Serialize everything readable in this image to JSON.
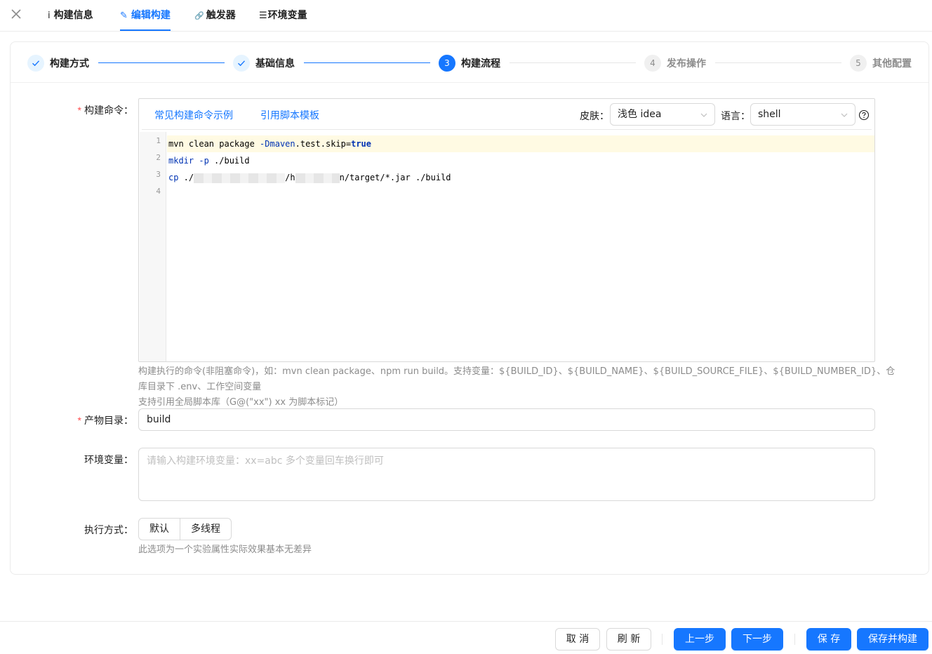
{
  "tabs": [
    {
      "icon": "i",
      "label": "构建信息"
    },
    {
      "icon": "✎",
      "label": "编辑构建"
    },
    {
      "icon": "🔗",
      "label": "触发器"
    },
    {
      "icon": "☰",
      "label": "环境变量"
    }
  ],
  "active_tab": "编辑构建",
  "steps": [
    {
      "index": "1",
      "title": "构建方式",
      "status": "done"
    },
    {
      "index": "2",
      "title": "基础信息",
      "status": "done"
    },
    {
      "index": "3",
      "title": "构建流程",
      "status": "current"
    },
    {
      "index": "4",
      "title": "发布操作",
      "status": "todo"
    },
    {
      "index": "5",
      "title": "其他配置",
      "status": "todo"
    }
  ],
  "command": {
    "label": "构建命令：",
    "toolbar": {
      "example_link": "常见构建命令示例",
      "template_link": "引用脚本模板",
      "skin_label": "皮肤：",
      "skin_value": "浅色 idea",
      "lang_label": "语言：",
      "lang_value": "shell"
    },
    "line_numbers": [
      "1",
      "2",
      "3",
      "4"
    ],
    "lines": {
      "l1": {
        "a": "mvn clean package ",
        "b": "-Dmaven",
        "c": ".test.skip=",
        "d": "true"
      },
      "l2": {
        "a": "mkdir",
        "b": " -p",
        "c": " ./build"
      },
      "l3": {
        "a": "cp",
        "b": " ./",
        "c": "/h",
        "d": "n/target/*.jar ./build"
      }
    },
    "hint1": "构建执行的命令(非阻塞命令)，如：mvn clean package、npm run build。支持变量：${BUILD_ID}、${BUILD_NAME}、${BUILD_SOURCE_FILE}、${BUILD_NUMBER_ID}、仓",
    "hint2": "库目录下 .env、工作空间变量",
    "hint3": "支持引用全局脚本库（G@(\"xx\") xx 为脚本标记）"
  },
  "artifact": {
    "label": "产物目录：",
    "value": "build"
  },
  "env": {
    "label": "环境变量：",
    "placeholder": "请输入构建环境变量：xx=abc 多个变量回车换行即可"
  },
  "exec": {
    "label": "执行方式：",
    "options": [
      "默认",
      "多线程"
    ],
    "hint": "此选项为一个实验属性实际效果基本无差异"
  },
  "footer": {
    "cancel": "取 消",
    "refresh": "刷 新",
    "prev": "上一步",
    "next": "下一步",
    "save": "保 存",
    "save_build": "保存并构建"
  },
  "colors": {
    "primary": "#1677ff",
    "required": "#ff4d4f",
    "hint": "#8c8c8c"
  }
}
